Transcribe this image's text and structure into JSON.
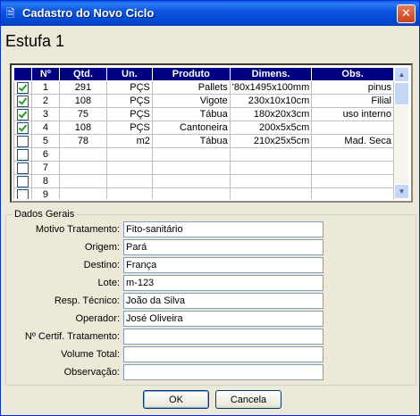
{
  "window": {
    "title": "Cadastro do Novo Ciclo",
    "icon": "document-icon"
  },
  "heading": "Estufa 1",
  "grid": {
    "columns": [
      "",
      "Nº",
      "Qtd.",
      "Un.",
      "Produto",
      "Dimens.",
      "Obs."
    ],
    "rows": [
      {
        "checked": true,
        "n": "1",
        "qtd": "291",
        "un": "PÇS",
        "produto": "Pallets",
        "dimens": "'80x1495x100mm",
        "obs": "pinus"
      },
      {
        "checked": true,
        "n": "2",
        "qtd": "108",
        "un": "PÇS",
        "produto": "Vigote",
        "dimens": "230x10x10cm",
        "obs": "Filial"
      },
      {
        "checked": true,
        "n": "3",
        "qtd": "75",
        "un": "PÇS",
        "produto": "Tábua",
        "dimens": "180x20x3cm",
        "obs": "uso interno"
      },
      {
        "checked": true,
        "n": "4",
        "qtd": "108",
        "un": "PÇS",
        "produto": "Cantoneira",
        "dimens": "200x5x5cm",
        "obs": ""
      },
      {
        "checked": false,
        "n": "5",
        "qtd": "78",
        "un": "m2",
        "produto": "Tábua",
        "dimens": "210x25x5cm",
        "obs": "Mad. Seca"
      },
      {
        "checked": false,
        "n": "6",
        "qtd": "",
        "un": "",
        "produto": "",
        "dimens": "",
        "obs": ""
      },
      {
        "checked": false,
        "n": "7",
        "qtd": "",
        "un": "",
        "produto": "",
        "dimens": "",
        "obs": ""
      },
      {
        "checked": false,
        "n": "8",
        "qtd": "",
        "un": "",
        "produto": "",
        "dimens": "",
        "obs": ""
      },
      {
        "checked": false,
        "n": "9",
        "qtd": "",
        "un": "",
        "produto": "",
        "dimens": "",
        "obs": ""
      }
    ]
  },
  "general": {
    "title": "Dados Gerais",
    "fields": [
      {
        "label": "Motivo Tratamento:",
        "value": "Fito-sanitário"
      },
      {
        "label": "Origem:",
        "value": "Pará"
      },
      {
        "label": "Destino:",
        "value": "França"
      },
      {
        "label": "Lote:",
        "value": "m-123"
      },
      {
        "label": "Resp. Técnico:",
        "value": "João da Silva"
      },
      {
        "label": "Operador:",
        "value": "José Oliveira"
      },
      {
        "label": "Nº Certif. Tratamento:",
        "value": ""
      },
      {
        "label": "Volume Total:",
        "value": ""
      },
      {
        "label": "Observação:",
        "value": ""
      }
    ]
  },
  "buttons": {
    "ok": "OK",
    "cancel": "Cancela"
  },
  "colors": {
    "titlebar": "#0148cf",
    "grid_header": "#000080",
    "dialog_bg": "#ece9d8"
  }
}
